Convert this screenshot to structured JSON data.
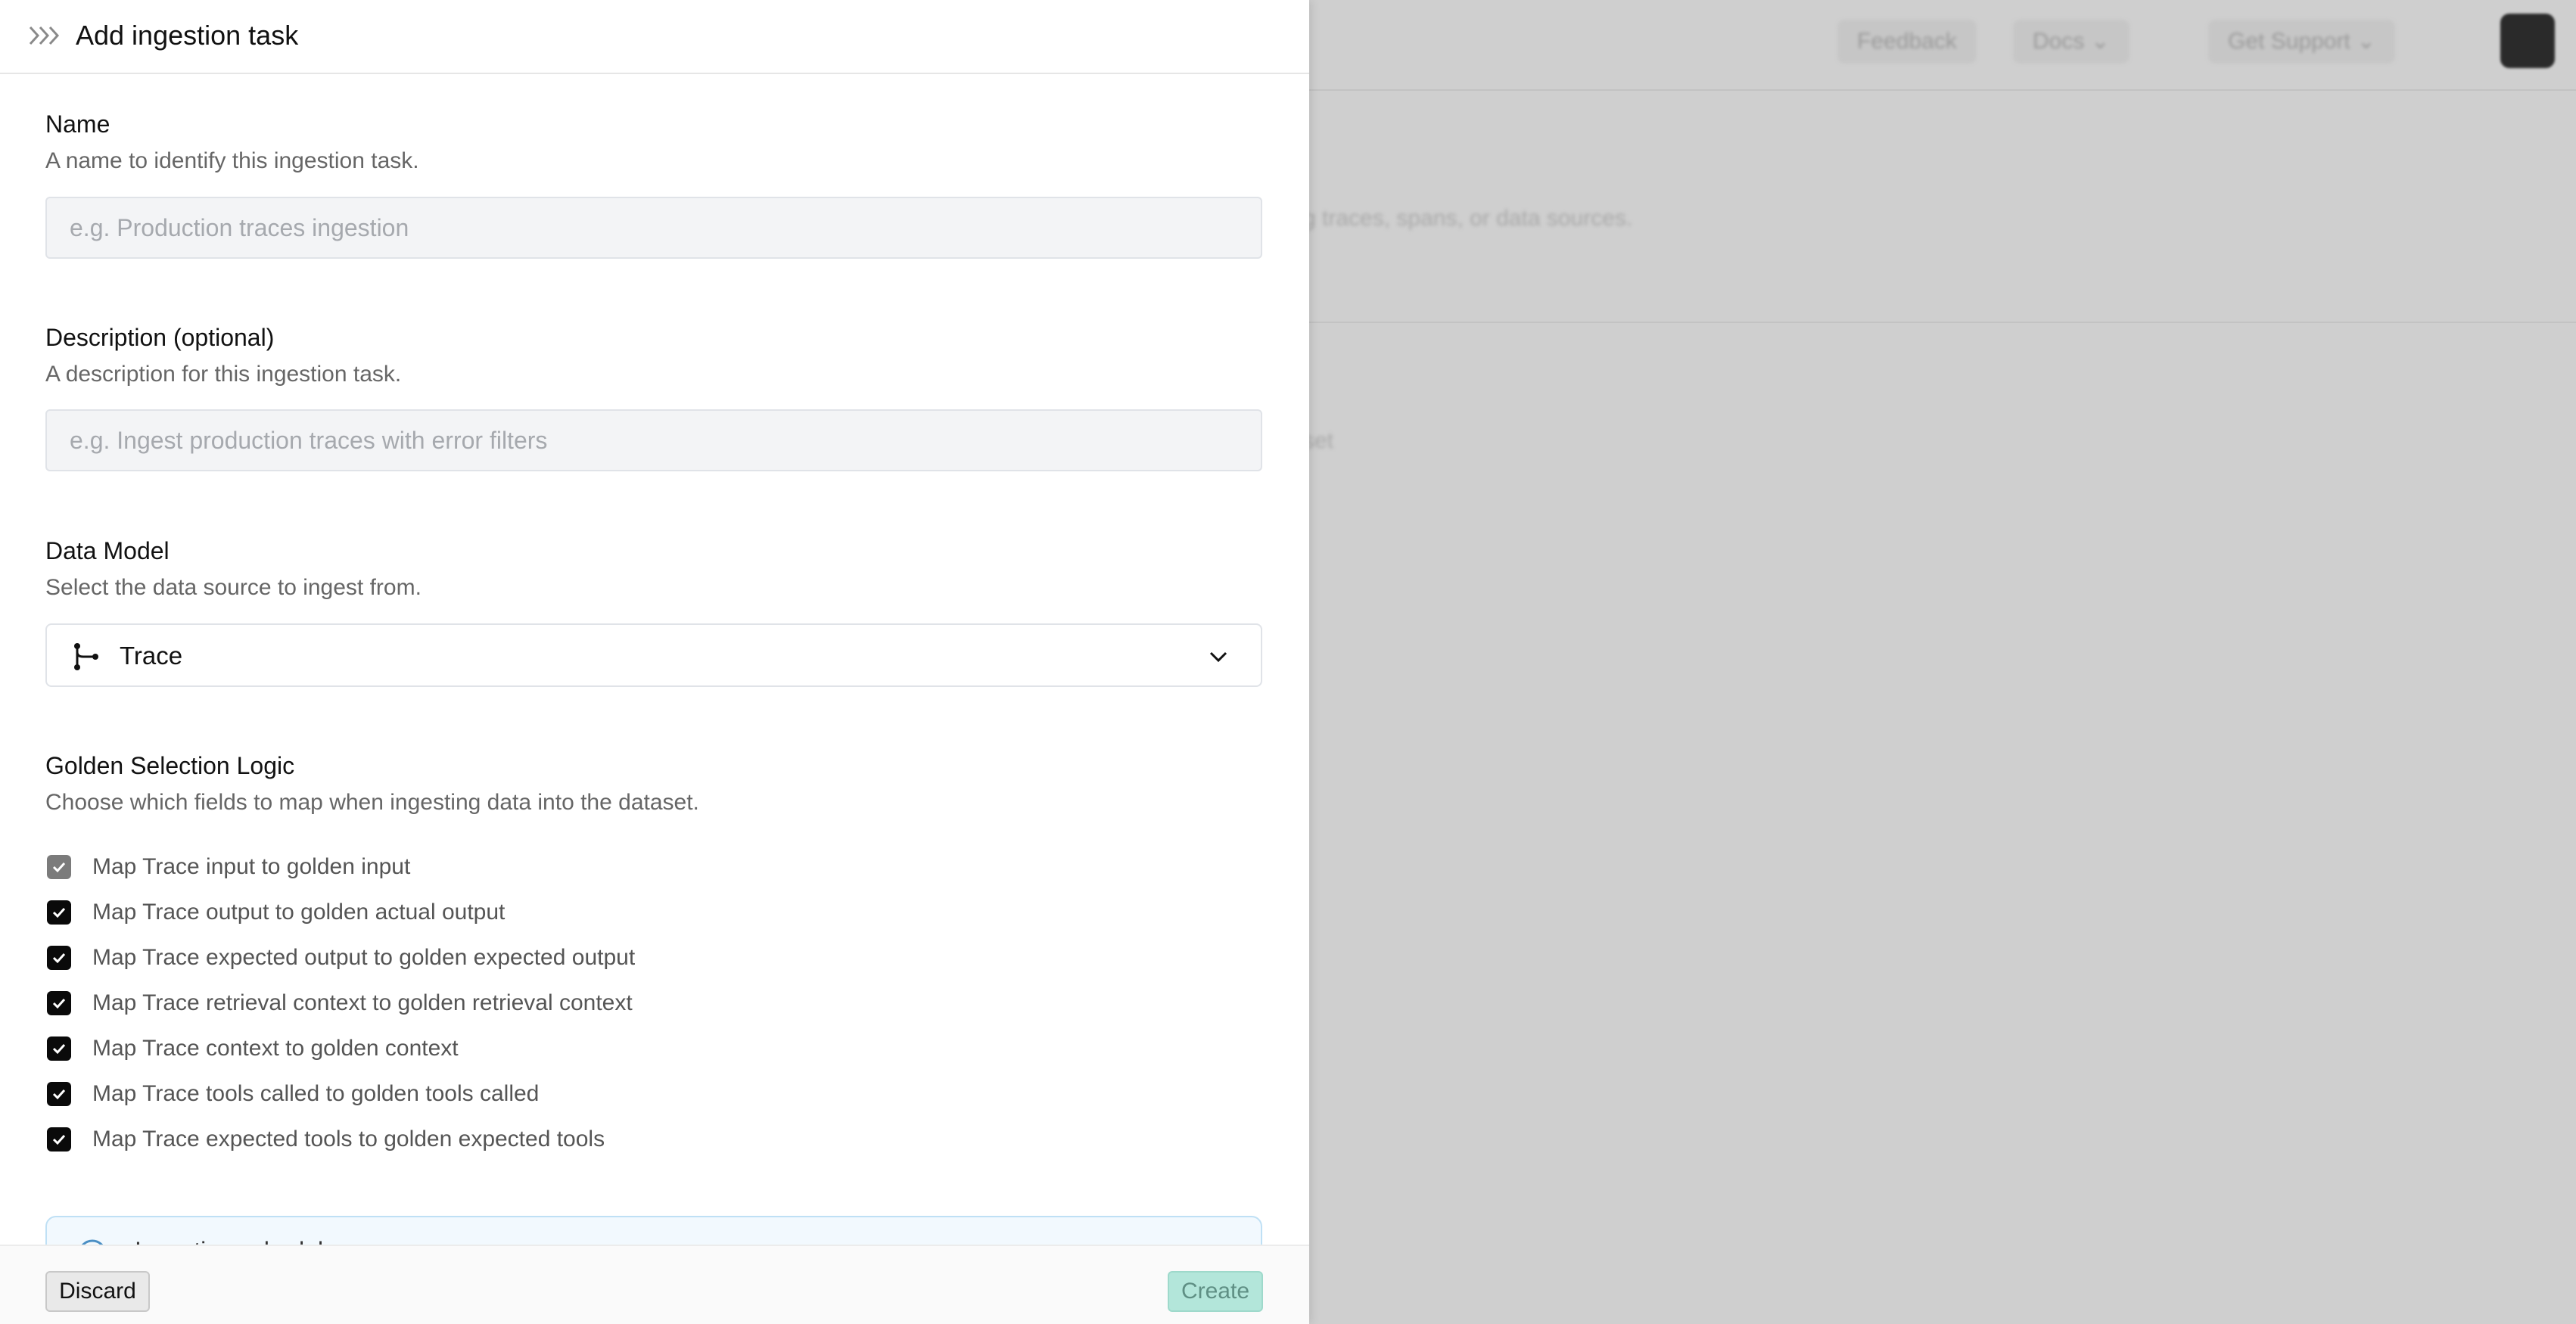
{
  "background": {
    "header_buttons": [
      {
        "label": "Feedback"
      },
      {
        "label": "Docs"
      },
      {
        "label": "Get Support"
      }
    ],
    "snippets": {
      "line1": "g traces, spans, or data sources.",
      "line2": "set"
    }
  },
  "drawer": {
    "title": "Add ingestion task",
    "name_section": {
      "title": "Name",
      "description": "A name to identify this ingestion task.",
      "placeholder": "e.g. Production traces ingestion",
      "value": ""
    },
    "description_section": {
      "title": "Description (optional)",
      "description": "A description for this ingestion task.",
      "placeholder": "e.g. Ingest production traces with error filters",
      "value": ""
    },
    "data_model_section": {
      "title": "Data Model",
      "description": "Select the data source to ingest from.",
      "selected": "Trace",
      "icon": "git-branch-icon"
    },
    "golden_section": {
      "title": "Golden Selection Logic",
      "description": "Choose which fields to map when ingesting data into the dataset.",
      "mappings": [
        {
          "label": "Map Trace input to golden input",
          "checked": true,
          "disabled": true
        },
        {
          "label": "Map Trace output to golden actual output",
          "checked": true,
          "disabled": false
        },
        {
          "label": "Map Trace expected output to golden expected output",
          "checked": true,
          "disabled": false
        },
        {
          "label": "Map Trace retrieval context to golden retrieval context",
          "checked": true,
          "disabled": false
        },
        {
          "label": "Map Trace context to golden context",
          "checked": true,
          "disabled": false
        },
        {
          "label": "Map Trace tools called to golden tools called",
          "checked": true,
          "disabled": false
        },
        {
          "label": "Map Trace expected tools to golden expected tools",
          "checked": true,
          "disabled": false
        }
      ]
    },
    "info_box": {
      "text": "Ingestion schedule"
    },
    "footer": {
      "discard_label": "Discard",
      "create_label": "Create"
    }
  },
  "colors": {
    "checkbox_checked": "#0a0a0a",
    "checkbox_disabled": "#7b7b7b",
    "create_button": "#b3e6da",
    "overlay": "#cfcfcf",
    "info_border": "#bfe0f5"
  }
}
